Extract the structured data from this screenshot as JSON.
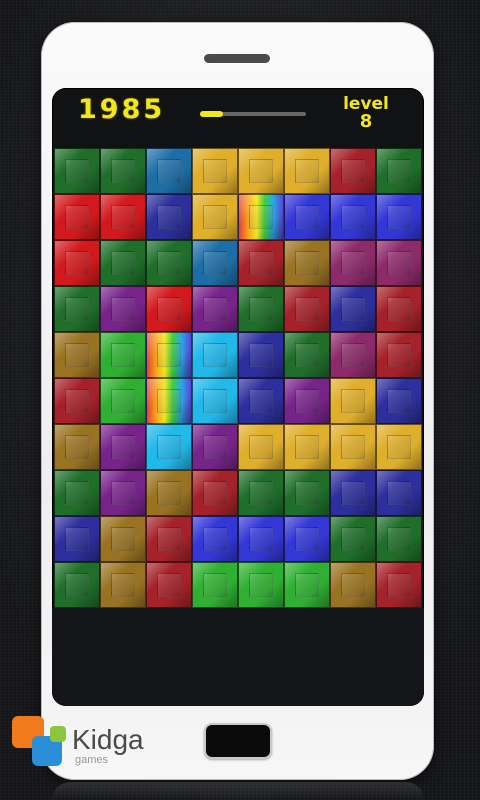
{
  "hud": {
    "score": "1985",
    "level_label": "level",
    "level_value": "8",
    "progress_fraction": 0.22
  },
  "colors": {
    "G": "#1f6e2a",
    "L": "#2fb032",
    "R": "#d2191d",
    "r": "#a5222a",
    "B": "#2d2f9c",
    "b": "#3337d6",
    "T": "#1d6ea6",
    "C": "#21b8ea",
    "Y": "#dfae2a",
    "O": "#9a7322",
    "P": "#77248a",
    "M": "#8c2a6a",
    "rainbow": "rainbow"
  },
  "board": [
    [
      "G",
      "G",
      "T",
      "Y",
      "Y",
      "Y",
      "r",
      "G"
    ],
    [
      "R",
      "R",
      "B",
      "Y",
      "rainbow",
      "b",
      "b",
      "b"
    ],
    [
      "R",
      "G",
      "G",
      "T",
      "r",
      "O",
      "M",
      "M"
    ],
    [
      "G",
      "P",
      "R",
      "P",
      "G",
      "r",
      "B",
      "r"
    ],
    [
      "O",
      "L",
      "rainbow",
      "C",
      "B",
      "G",
      "M",
      "r"
    ],
    [
      "r",
      "L",
      "rainbow",
      "C",
      "B",
      "P",
      "Y",
      "B"
    ],
    [
      "O",
      "P",
      "C",
      "P",
      "Y",
      "Y",
      "Y",
      "Y"
    ],
    [
      "G",
      "P",
      "O",
      "r",
      "G",
      "G",
      "B",
      "B"
    ],
    [
      "B",
      "O",
      "r",
      "b",
      "b",
      "b",
      "G",
      "G"
    ],
    [
      "G",
      "O",
      "r",
      "L",
      "L",
      "L",
      "O",
      "r"
    ]
  ],
  "logo": {
    "name": "Kidga",
    "sub": "games"
  }
}
